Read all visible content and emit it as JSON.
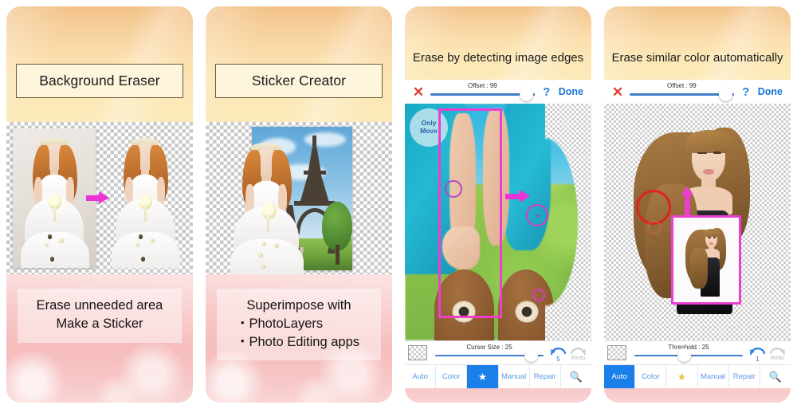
{
  "app": {
    "name": "Background Eraser",
    "screenshot_set": "App Store preview — 4 phone screenshots"
  },
  "colors": {
    "header_gradient_top": "#f2c186",
    "header_gradient_bottom": "#fbeab9",
    "footer_pink": "#f6bcbc",
    "accent_blue": "#1a7fe8",
    "tab_text_blue": "#5b9bdf",
    "done_blue": "#1673d4",
    "close_red": "#e03b32",
    "marker_magenta": "#ec3fd0",
    "marker_red": "#e1211c",
    "title_box_border": "#6d5a36",
    "title_box_fill": "#fdf6dd"
  },
  "panels": [
    {
      "id": "panel-1",
      "kind": "promo",
      "header_title": "Background Eraser",
      "header_title_boxed": true,
      "caption_lines": [
        "Erase unneeded area",
        "Make a Sticker"
      ],
      "media": {
        "type": "before-after",
        "before_label": "original photo on studio background",
        "after_label": "cut-out bride on transparency checkerboard",
        "arrow": "right-arrow-magenta"
      }
    },
    {
      "id": "panel-2",
      "kind": "promo",
      "header_title": "Sticker Creator",
      "header_title_boxed": true,
      "caption_lines": [
        "Superimpose with",
        "・PhotoLayers",
        "・Photo Editing apps"
      ],
      "media": {
        "type": "composite",
        "label": "bride sticker pasted over Eiffel Tower photo on transparency checkerboard"
      }
    },
    {
      "id": "panel-3",
      "kind": "editor",
      "header_title": "Erase by detecting image edges",
      "header_title_boxed": false,
      "toolbar_top": {
        "close_icon": "close-x-icon",
        "slider_label": "Offset : 99",
        "slider_value": 99,
        "slider_percent": 92,
        "help_icon": "question-mark-icon",
        "done_label": "Done"
      },
      "canvas": {
        "badge_text_line1": "Only",
        "badge_text_line2": "Move",
        "annotation": "magenta selection rectangle over left half; right edge shows erased transparency"
      },
      "toolbar_bottom": {
        "swatch": "transparency-checker-swatch",
        "slider_label": "Cursor Size : 25",
        "slider_value": 25,
        "slider_percent": 86,
        "undo_label": "5",
        "redo_label": "Redo"
      },
      "tabs": [
        {
          "label": "Auto",
          "active": false,
          "icon": ""
        },
        {
          "label": "Color",
          "active": false,
          "icon": ""
        },
        {
          "label": "",
          "active": true,
          "icon": "star-icon"
        },
        {
          "label": "Manual",
          "active": false,
          "icon": ""
        },
        {
          "label": "Repair",
          "active": false,
          "icon": ""
        },
        {
          "label": "",
          "active": false,
          "icon": "magnifier-icon"
        }
      ]
    },
    {
      "id": "panel-4",
      "kind": "editor",
      "header_title": "Erase similar color automatically",
      "header_title_boxed": false,
      "toolbar_top": {
        "close_icon": "close-x-icon",
        "slider_label": "Offset : 99",
        "slider_value": 99,
        "slider_percent": 92,
        "help_icon": "question-mark-icon",
        "done_label": "Done"
      },
      "canvas": {
        "annotation": "model cut out onto transparency; red circle highlights hair edge; magenta inset shows original photo"
      },
      "toolbar_bottom": {
        "swatch": "transparency-checker-swatch",
        "slider_label": "Threshold : 25",
        "slider_value": 25,
        "slider_percent": 44,
        "undo_label": "1",
        "redo_label": "Redo"
      },
      "tabs": [
        {
          "label": "Auto",
          "active": true,
          "icon": ""
        },
        {
          "label": "Color",
          "active": false,
          "icon": ""
        },
        {
          "label": "",
          "active": false,
          "icon": "star-icon"
        },
        {
          "label": "Manual",
          "active": false,
          "icon": ""
        },
        {
          "label": "Repair",
          "active": false,
          "icon": ""
        },
        {
          "label": "",
          "active": false,
          "icon": "magnifier-icon"
        }
      ]
    }
  ]
}
